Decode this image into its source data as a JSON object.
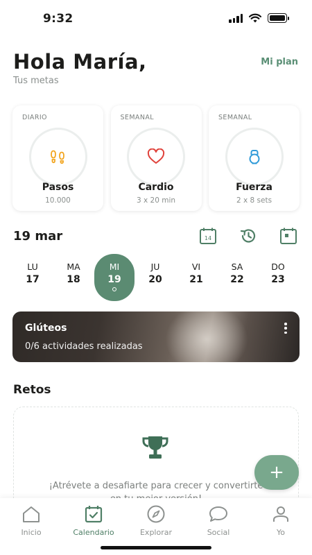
{
  "status_bar": {
    "time": "9:32"
  },
  "header": {
    "greeting": "Hola María,",
    "subtitle": "Tus metas",
    "plan_link": "Mi plan"
  },
  "goals": [
    {
      "period": "DIARIO",
      "name": "Pasos",
      "target": "10.000",
      "icon": "footsteps-icon",
      "icon_color": "#f2a51f"
    },
    {
      "period": "SEMANAL",
      "name": "Cardio",
      "target": "3 x 20 min",
      "icon": "heart-icon",
      "icon_color": "#e0413a"
    },
    {
      "period": "SEMANAL",
      "name": "Fuerza",
      "target": "2 x 8 sets",
      "icon": "kettlebell-icon",
      "icon_color": "#2f9ad8"
    }
  ],
  "date": {
    "title": "19 mar",
    "calendar_day": "14"
  },
  "week": [
    {
      "abbr": "LU",
      "num": "17"
    },
    {
      "abbr": "MA",
      "num": "18"
    },
    {
      "abbr": "MI",
      "num": "19",
      "selected": true
    },
    {
      "abbr": "JU",
      "num": "20"
    },
    {
      "abbr": "VI",
      "num": "21"
    },
    {
      "abbr": "SA",
      "num": "22"
    },
    {
      "abbr": "DO",
      "num": "23"
    }
  ],
  "workout": {
    "title": "Glúteos",
    "progress": "0/6 actividades realizadas"
  },
  "retos": {
    "title": "Retos",
    "message_line1": "¡Atrévete a desafiarte para crecer y convertirte",
    "message_line2": "en tu mejor versión!"
  },
  "fab": {
    "label": "+"
  },
  "nav": [
    {
      "label": "Inicio",
      "icon": "home-icon"
    },
    {
      "label": "Calendario",
      "icon": "calendar-check-icon",
      "active": true
    },
    {
      "label": "Explorar",
      "icon": "compass-icon"
    },
    {
      "label": "Social",
      "icon": "chat-bubble-icon"
    },
    {
      "label": "Yo",
      "icon": "user-icon"
    }
  ],
  "colors": {
    "accent": "#5b8b72",
    "fab": "#79a88d",
    "icon_green": "#4f7f66",
    "muted_text": "#8a8f8d"
  }
}
